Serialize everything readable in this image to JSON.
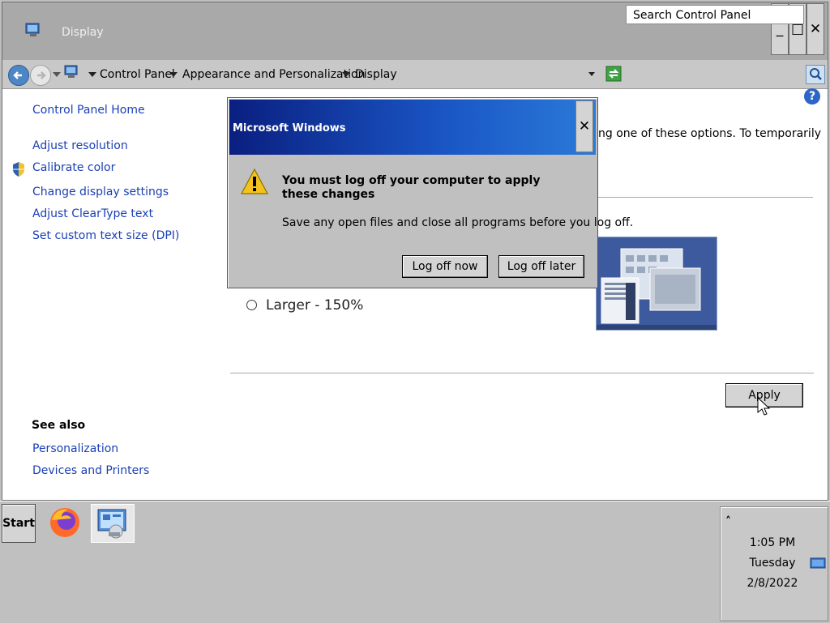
{
  "window": {
    "title": "Display",
    "controls": {
      "minimize": "_",
      "maximize": "□",
      "close": "✕"
    }
  },
  "address": {
    "crumbs": [
      "Control Panel",
      "Appearance and Personalization",
      "Display"
    ],
    "search_placeholder": "Search Control Panel"
  },
  "sidebar": {
    "home": "Control Panel Home",
    "items": [
      "Adjust resolution",
      "Calibrate color",
      "Change display settings",
      "Adjust ClearType text",
      "Set custom text size (DPI)"
    ],
    "see_also_heading": "See also",
    "see_also": [
      "Personalization",
      "Devices and Printers"
    ]
  },
  "content": {
    "intro_fragment": "ng one of these options. To temporarily",
    "radio_label": "Larger - 150%",
    "apply_label": "Apply"
  },
  "dialog": {
    "title": "Microsoft Windows",
    "close": "✕",
    "message": "You must log off your computer to apply these changes",
    "sub": "Save any open files and close all programs before you log off.",
    "buttons": [
      "Log off now",
      "Log off later"
    ]
  },
  "taskbar": {
    "start": "Start",
    "clock": {
      "time": "1:05 PM",
      "day": "Tuesday",
      "date": "2/8/2022"
    },
    "tray_chevron": "˄"
  },
  "colors": {
    "link": "#1a3fb5",
    "dialog_title_start": "#0a1f80",
    "dialog_title_end": "#2b7ad8"
  },
  "icons": [
    "control-panel-icon",
    "back-arrow-icon",
    "forward-arrow-icon",
    "refresh-icon",
    "search-icon",
    "help-icon",
    "shield-icon",
    "warning-icon",
    "firefox-icon",
    "display-settings-icon",
    "network-icon"
  ]
}
